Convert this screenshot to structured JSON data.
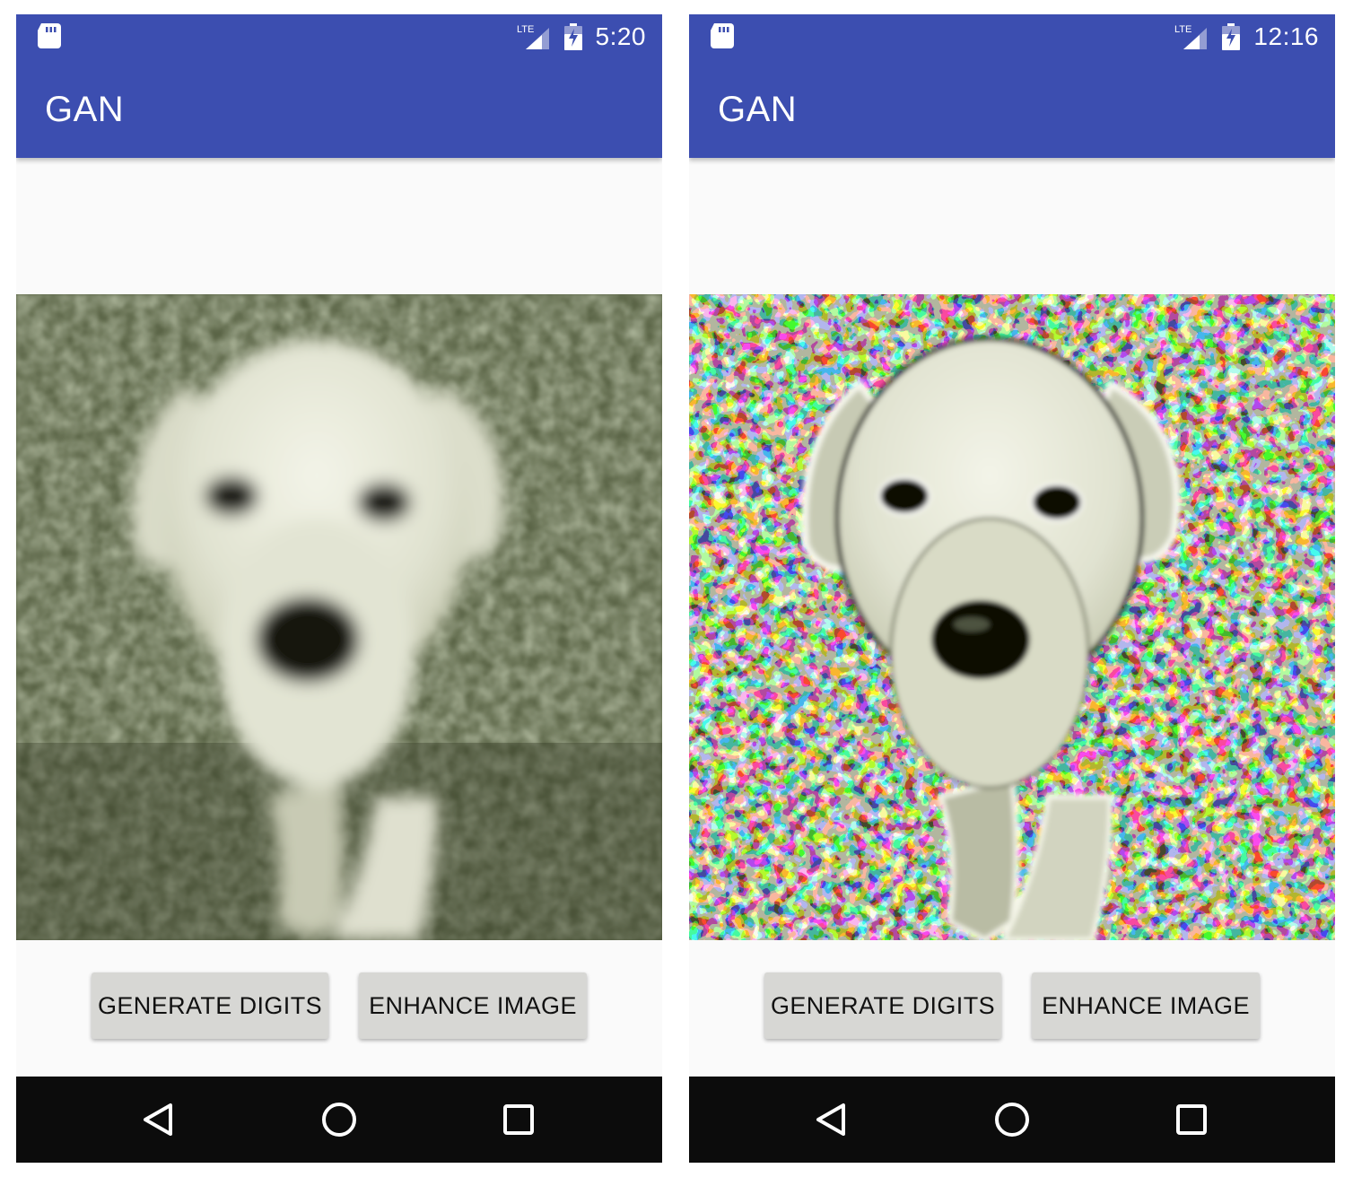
{
  "screens": [
    {
      "status_bar": {
        "network_label": "LTE",
        "time": "5:20"
      },
      "app_bar": {
        "title": "GAN"
      },
      "image": {
        "description_icon": "dog-photo",
        "style": "blurred"
      },
      "buttons": {
        "generate": "GENERATE DIGITS",
        "enhance": "ENHANCE IMAGE"
      },
      "nav_icons": [
        "back-icon",
        "home-icon",
        "recents-icon"
      ]
    },
    {
      "status_bar": {
        "network_label": "LTE",
        "time": "12:16"
      },
      "app_bar": {
        "title": "GAN"
      },
      "image": {
        "description_icon": "dog-photo",
        "style": "enhanced"
      },
      "buttons": {
        "generate": "GENERATE DIGITS",
        "enhance": "ENHANCE IMAGE"
      },
      "nav_icons": [
        "back-icon",
        "home-icon",
        "recents-icon"
      ]
    }
  ],
  "colors": {
    "app_bar": "#3c4eb0",
    "background": "#fafafa",
    "button": "#d7d7d4",
    "nav_bar": "#0c0c0c",
    "grass_blur": "#5a6446",
    "grass_dark": "#14180c",
    "dog_fur": "#e4e6d6"
  }
}
